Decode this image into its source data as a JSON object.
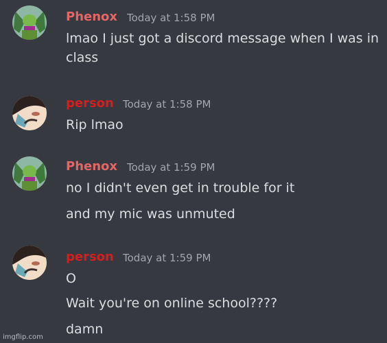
{
  "messages": [
    {
      "author": "Phenox",
      "author_color": "#e46767",
      "timestamp": "Today at 1:58 PM",
      "avatar": "green-character-avatar-icon",
      "lines": [
        "lmao I just got a discord message when I was in class"
      ]
    },
    {
      "author": "person",
      "author_color": "#d21f1f",
      "timestamp": "Today at 1:58 PM",
      "avatar": "anime-face-avatar-icon",
      "lines": [
        "Rip lmao"
      ]
    },
    {
      "author": "Phenox",
      "author_color": "#e46767",
      "timestamp": "Today at 1:59 PM",
      "avatar": "green-character-avatar-icon",
      "lines": [
        "no I didn't even get in trouble for it",
        "and my mic was unmuted"
      ]
    },
    {
      "author": "person",
      "author_color": "#d21f1f",
      "timestamp": "Today at 1:59 PM",
      "avatar": "anime-face-avatar-icon",
      "lines": [
        "O",
        "Wait you're on online school????",
        "damn"
      ]
    }
  ],
  "watermark": "imgflip.com"
}
